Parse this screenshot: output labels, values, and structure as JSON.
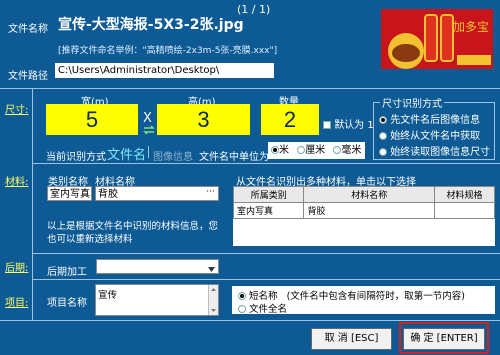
{
  "window": {
    "counter": "(1 / 1)"
  },
  "file": {
    "name_label": "文件名称",
    "name_value": "宣传-大型海报-5X3-2张.jpg",
    "hint": "[推荐文件命名举例：\"高精喷绘-2x3m-5张-亮膜.xxx\"]",
    "path_label": "文件路径",
    "path_value": "C:\\Users\\Administrator\\Desktop\\"
  },
  "size": {
    "section_label": "尺寸:",
    "width_label": "宽(m)",
    "width_value": "5",
    "x_sign": "X",
    "height_label": "高(m)",
    "height_value": "3",
    "qty_label": "数量",
    "qty_value": "2",
    "default_one_label": "默认为 1",
    "current_method_label": "当前识别方式",
    "method_filename": "文件名",
    "method_image": "图像信息",
    "unit_label": "文件名中单位为",
    "units": [
      "米",
      "厘米",
      "毫米"
    ],
    "recog_group_title": "尺寸识别方式",
    "recog_options": [
      "先文件名后图像信息",
      "始终从文件名中获取",
      "始终读取图像信息尺寸"
    ]
  },
  "material": {
    "section_label": "材料:",
    "category_label": "类别名称",
    "category_value": "室内写真",
    "material_label": "材料名称",
    "material_value": "背胶",
    "more_btn": "···",
    "note": "以上是根据文件名中识别的材料信息，您也可以重新选择材料",
    "multi_title": "从文件名识别出多种材料，单击以下选择",
    "table": {
      "headers": [
        "所属类别",
        "材料名称",
        "材料规格"
      ],
      "rows": [
        [
          "室内写真",
          "背胶",
          ""
        ]
      ]
    }
  },
  "post": {
    "section_label": "后期:",
    "label": "后期加工",
    "value": ""
  },
  "project": {
    "section_label": "项目:",
    "label": "项目名称",
    "value": "宣传",
    "opt_short": "短名称",
    "opt_short_desc": "(文件名中包含有间隔符时，取第一节内容)",
    "opt_full": "文件全名"
  },
  "buttons": {
    "cancel": "取 消 [ESC]",
    "ok": "确 定 [ENTER]"
  },
  "colors": {
    "background": "#0d5a94",
    "highlight": "#ffff00",
    "ok_border": "#d02020"
  }
}
